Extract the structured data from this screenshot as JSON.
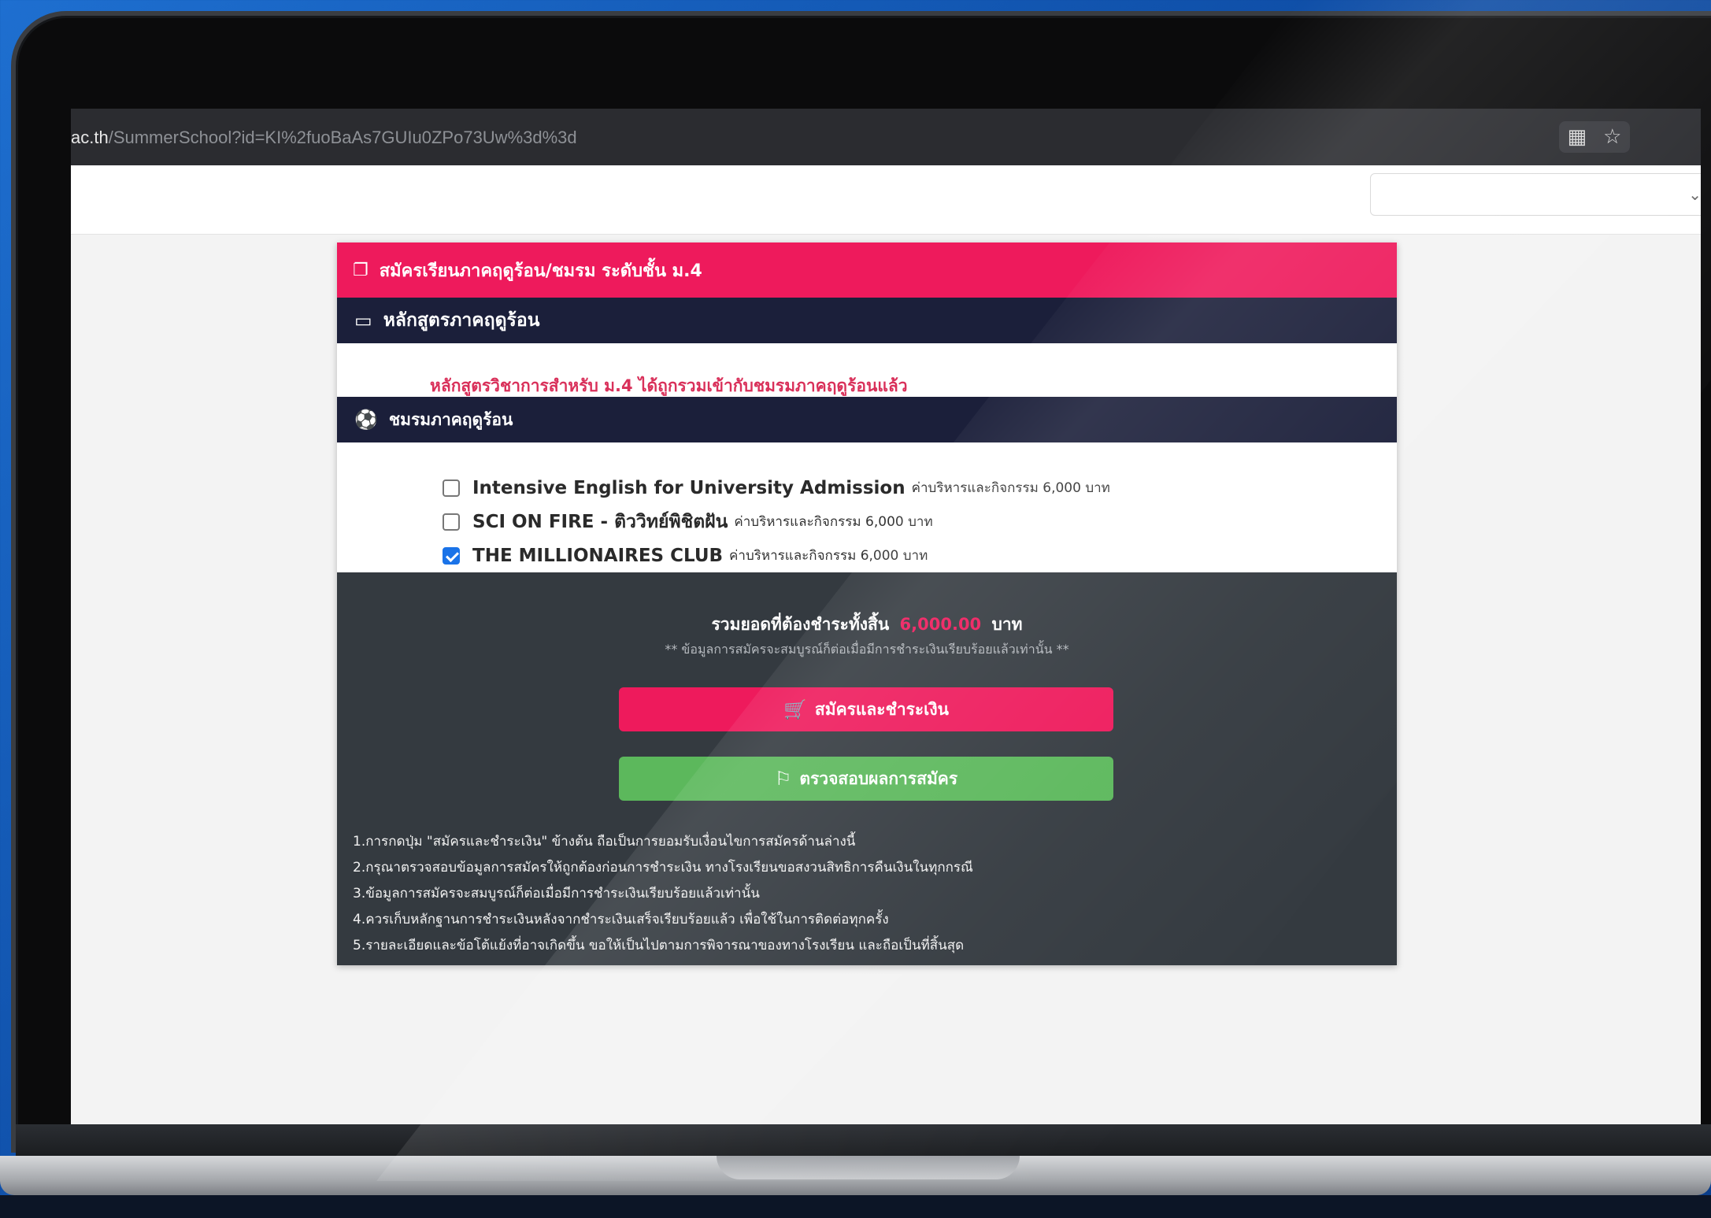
{
  "browser": {
    "url_host": "ac.th",
    "url_path": "/SummerSchool?id=KI%2fuoBaAs7GUIu0ZPo73Uw%3d%3d",
    "reader_icon": "reader-mode-icon",
    "star_icon": "bookmark-star-icon"
  },
  "form": {
    "header_title": "สมัครเรียนภาคฤดูร้อน/ชมรม ระดับชั้น ม.4",
    "course_section_title": "หลักสูตรภาคฤดูร้อน",
    "course_note": "หลักสูตรวิชาการสำหรับ ม.4 ได้ถูกรวมเข้ากับชมรมภาคฤดูร้อนแล้ว",
    "clubs_section_title": "ชมรมภาคฤดูร้อน",
    "clubs": [
      {
        "name": "Intensive English for University Admission",
        "desc": "ค่าบริหารและกิจกรรม 6,000 บาท",
        "checked": false
      },
      {
        "name": "SCI ON FIRE - ติววิทย์พิชิตฝัน",
        "desc": "ค่าบริหารและกิจกรรม 6,000 บาท",
        "checked": false
      },
      {
        "name": "THE MILLIONAIRES CLUB",
        "desc": "ค่าบริหารและกิจกรรม 6,000 บาท",
        "checked": true
      }
    ]
  },
  "summary": {
    "total_label": "รวมยอดที่ต้องชำระทั้งสิ้น",
    "total_amount": "6,000.00",
    "total_unit": "บาท",
    "total_note": "** ข้อมูลการสมัครจะสมบูรณ์ก็ต่อเมื่อมีการชำระเงินเรียบร้อยแล้วเท่านั้น **",
    "pay_button": "สมัครและชำระเงิน",
    "check_button": "ตรวจสอบผลการสมัคร",
    "terms": [
      "1.การกดปุ่ม \"สมัครและชำระเงิน\" ข้างต้น ถือเป็นการยอมรับเงื่อนไขการสมัครด้านล่างนี้",
      "2.กรุณาตรวจสอบข้อมูลการสมัครให้ถูกต้องก่อนการชำระเงิน ทางโรงเรียนขอสงวนสิทธิการคืนเงินในทุกกรณี",
      "3.ข้อมูลการสมัครจะสมบูรณ์ก็ต่อเมื่อมีการชำระเงินเรียบร้อยแล้วเท่านั้น",
      "4.ควรเก็บหลักฐานการชำระเงินหลังจากชำระเงินเสร็จเรียบร้อยแล้ว เพื่อใช้ในการติดต่อทุกครั้ง",
      "5.รายละเอียดและข้อโต้แย้งที่อาจเกิดขึ้น ขอให้เป็นไปตามการพิจารณาของทางโรงเรียน และถือเป็นที่สิ้นสุด"
    ]
  },
  "colors": {
    "accent_pink": "#ee1a5c",
    "navy": "#1b1f3a",
    "panel_dark": "#343a40",
    "success_green": "#5cb85c"
  }
}
